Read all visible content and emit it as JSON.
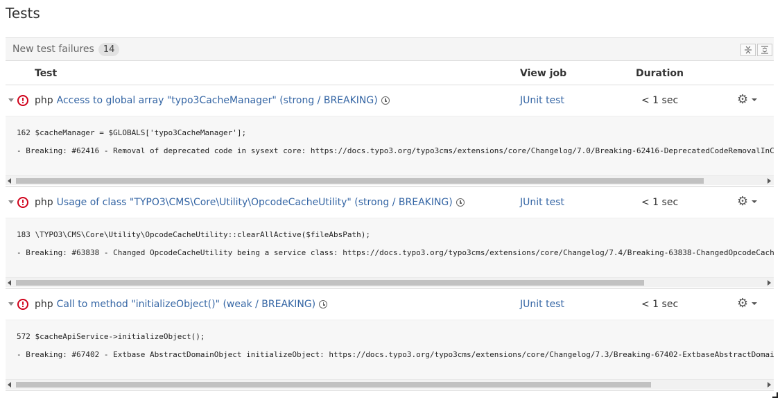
{
  "page": {
    "title": "Tests"
  },
  "panel": {
    "title": "New test failures",
    "count": "14",
    "collapse_all_icon": "collapse-all-icon",
    "expand_all_icon": "expand-all-icon"
  },
  "table": {
    "headers": {
      "test": "Test",
      "view_job": "View job",
      "duration": "Duration"
    }
  },
  "rows": [
    {
      "prefix": "php",
      "name": "Access to global array \"typo3CacheManager\" (strong / BREAKING)",
      "job": "JUnit test",
      "duration": "< 1 sec",
      "code_line_1": "162 $cacheManager = $GLOBALS['typo3CacheManager'];",
      "code_line_2": "- Breaking: #62416 - Removal of deprecated code in sysext core: https://docs.typo3.org/typo3cms/extensions/core/Changelog/7.0/Breaking-62416-DeprecatedCodeRemovalInC",
      "scroll_position": 0.0,
      "scroll_visible_fraction": 0.92
    },
    {
      "prefix": "php",
      "name": "Usage of class \"TYPO3\\CMS\\Core\\Utility\\OpcodeCacheUtility\" (strong / BREAKING)",
      "job": "JUnit test",
      "duration": "< 1 sec",
      "code_line_1": "183 \\TYPO3\\CMS\\Core\\Utility\\OpcodeCacheUtility::clearAllActive($fileAbsPath);",
      "code_line_2": "- Breaking: #63838 - Changed OpcodeCacheUtility being a service class: https://docs.typo3.org/typo3cms/extensions/core/Changelog/7.4/Breaking-63838-ChangedOpcodeCach",
      "scroll_position": 0.0,
      "scroll_visible_fraction": 0.84
    },
    {
      "prefix": "php",
      "name": "Call to method \"initializeObject()\" (weak / BREAKING)",
      "job": "JUnit test",
      "duration": "< 1 sec",
      "code_line_1": "572 $cacheApiService->initializeObject();",
      "code_line_2": "- Breaking: #67402 - Extbase AbstractDomainObject initializeObject: https://docs.typo3.org/typo3cms/extensions/core/Changelog/7.3/Breaking-67402-ExtbaseAbstractDomai",
      "scroll_position": 0.0,
      "scroll_visible_fraction": 0.85
    }
  ],
  "colors": {
    "link": "#3465a4",
    "error": "#d0021b"
  }
}
